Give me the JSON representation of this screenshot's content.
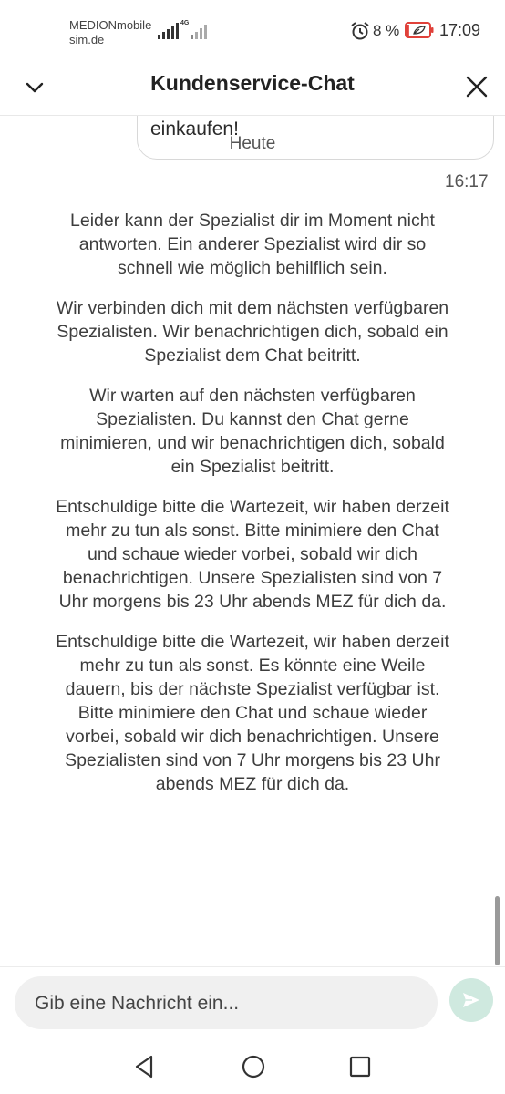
{
  "status_bar": {
    "carrier_line1": "MEDIONmobile",
    "carrier_line2": "sim.de",
    "network_type": "4G",
    "battery_percent": "8 %",
    "battery_level": 0.08,
    "time": "17:09",
    "icons": [
      "signal-icon",
      "alarm-icon",
      "battery-icon"
    ]
  },
  "header": {
    "title": "Kundenservice-Chat",
    "back_icon": "chevron-down-icon",
    "close_icon": "close-icon"
  },
  "chat": {
    "previous_bubble_text": "einkaufen!",
    "day_separator": "Heute",
    "timestamp": "16:17",
    "messages": [
      "Leider kann der Spezialist dir im Moment nicht antworten. Ein anderer Spezialist wird dir so schnell wie möglich behilflich sein.",
      "Wir verbinden dich mit dem nächsten verfügbaren Spezialisten. Wir benachrichtigen dich, sobald ein Spezialist dem Chat beitritt.",
      "Wir warten auf den nächsten verfügbaren Spezialisten. Du kannst den Chat gerne minimieren, und wir benachrichtigen dich, sobald ein Spezialist beitritt.",
      "Entschuldige bitte die Wartezeit, wir haben derzeit mehr zu tun als sonst. Bitte minimiere den Chat und schaue wieder vorbei, sobald wir dich benachrichtigen. Unsere Spezialisten sind von 7 Uhr morgens bis 23 Uhr abends MEZ für dich da.",
      "Entschuldige bitte die Wartezeit, wir haben derzeit mehr zu tun als sonst. Es könnte eine Weile dauern, bis der nächste Spezialist verfügbar ist. Bitte minimiere den Chat und schaue wieder vorbei, sobald wir dich benachrichtigen. Unsere Spezialisten sind von 7 Uhr morgens bis 23 Uhr abends MEZ für dich da."
    ]
  },
  "composer": {
    "placeholder": "Gib eine Nachricht ein...",
    "value": "",
    "send_icon": "send-icon",
    "send_color": "#cfe9df"
  },
  "navbar": {
    "icons": [
      "nav-back-icon",
      "nav-home-icon",
      "nav-recents-icon"
    ]
  },
  "colors": {
    "text": "#3d3d3d",
    "accent_light_green": "#cfe9df",
    "battery_low": "#e0413a"
  }
}
